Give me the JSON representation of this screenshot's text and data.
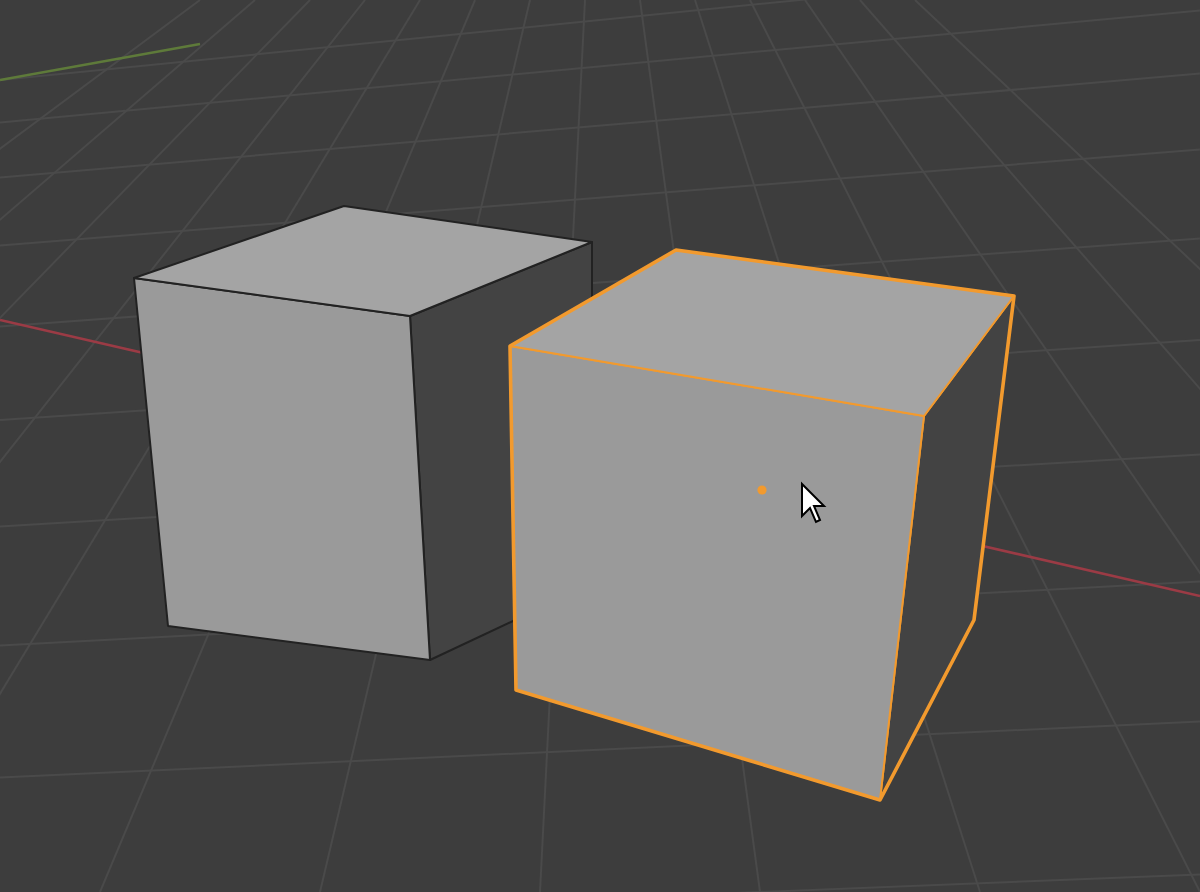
{
  "viewport": {
    "objects": [
      {
        "kind": "cube",
        "selected": false
      },
      {
        "kind": "cube",
        "selected": true
      }
    ]
  }
}
